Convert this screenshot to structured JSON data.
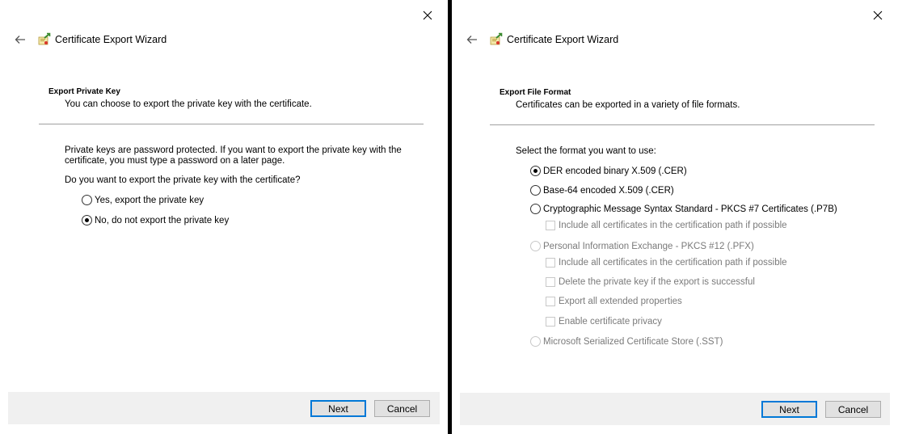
{
  "left": {
    "wizard_title": "Certificate Export Wizard",
    "heading": "Export Private Key",
    "subheading": "You can choose to export the private key with the certificate.",
    "info_line1": "Private keys are password protected. If you want to export the private key with the",
    "info_line2": "certificate, you must type a password on a later page.",
    "question": "Do you want to export the private key with the certificate?",
    "options": [
      {
        "label": "Yes, export the private key",
        "checked": false
      },
      {
        "label": "No, do not export the private key",
        "checked": true
      }
    ],
    "next_label": "Next",
    "cancel_label": "Cancel"
  },
  "right": {
    "wizard_title": "Certificate Export Wizard",
    "heading": "Export File Format",
    "subheading": "Certificates can be exported in a variety of file formats.",
    "prompt": "Select the format you want to use:",
    "formats": [
      {
        "label": "DER encoded binary X.509 (.CER)",
        "checked": true,
        "enabled": true
      },
      {
        "label": "Base-64 encoded X.509 (.CER)",
        "checked": false,
        "enabled": true
      },
      {
        "label": "Cryptographic Message Syntax Standard - PKCS #7 Certificates (.P7B)",
        "checked": false,
        "enabled": true
      },
      {
        "label": "Personal Information Exchange - PKCS #12 (.PFX)",
        "checked": false,
        "enabled": false
      },
      {
        "label": "Microsoft Serialized Certificate Store (.SST)",
        "checked": false,
        "enabled": false
      }
    ],
    "p7b_include_path": "Include all certificates in the certification path if possible",
    "pfx_options": [
      "Include all certificates in the certification path if possible",
      "Delete the private key if the export is successful",
      "Export all extended properties",
      "Enable certificate privacy"
    ],
    "next_label": "Next",
    "cancel_label": "Cancel"
  },
  "icons": {
    "close": "close-icon",
    "back": "back-arrow-icon",
    "wizard": "certificate-wizard-icon"
  }
}
